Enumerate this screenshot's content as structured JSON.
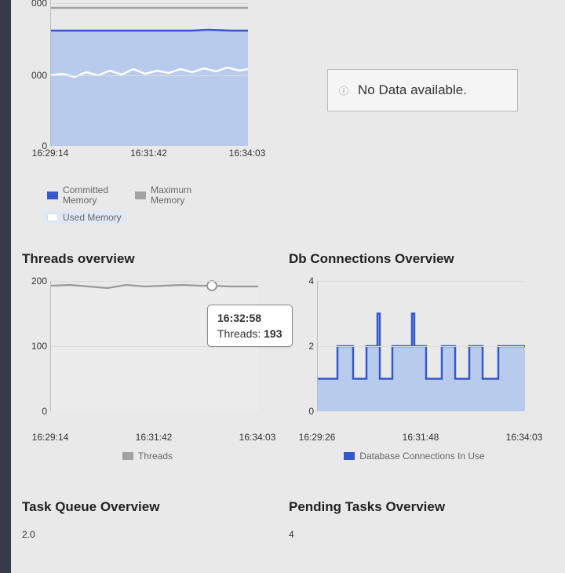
{
  "sidebar": {},
  "nodata": {
    "text": "No Data available."
  },
  "mem_chart": {
    "y_ticks": [
      "000",
      "000",
      "0"
    ],
    "x_ticks": [
      "16:29:14",
      "16:31:42",
      "16:34:03"
    ],
    "legend": {
      "committed": "Committed Memory",
      "maximum": "Maximum Memory",
      "used": "Used Memory"
    }
  },
  "threads_panel": {
    "title": "Threads overview",
    "y_ticks": [
      "200",
      "100",
      "0"
    ],
    "x_ticks": [
      "16:29:14",
      "16:31:42",
      "16:34:03"
    ],
    "legend": {
      "threads": "Threads"
    },
    "tooltip": {
      "time": "16:32:58",
      "label": "Threads:",
      "value": "193"
    }
  },
  "db_panel": {
    "title": "Db Connections Overview",
    "y_ticks": [
      "4",
      "2",
      "0"
    ],
    "x_ticks": [
      "16:29:26",
      "16:31:48",
      "16:34:03"
    ],
    "legend": {
      "db": "Database Connections In Use"
    }
  },
  "task_queue": {
    "title": "Task Queue Overview",
    "first_tick": "2.0"
  },
  "pending_tasks": {
    "title": "Pending Tasks Overview",
    "first_tick": "4"
  },
  "colors": {
    "series_blue": "#3558cc",
    "area_blue": "#b9cbec",
    "grey": "#b0b0b0",
    "white_line": "#ffffff"
  },
  "chart_data": [
    {
      "type": "area",
      "title": "Memory (partial, top cropped)",
      "legend": [
        "Committed Memory",
        "Maximum Memory",
        "Used Memory"
      ],
      "x": [
        "16:29:14",
        "16:31:42",
        "16:34:03"
      ],
      "series": [
        {
          "name": "Committed Memory",
          "note": "flat line near top of visible area",
          "values_relative_0_1": [
            0.795,
            0.795,
            0.795
          ]
        },
        {
          "name": "Maximum Memory",
          "note": "horizontal grey line at very top",
          "values_relative_0_1": [
            0.95,
            0.95,
            0.95
          ]
        },
        {
          "name": "Used Memory",
          "note": "white line over filled area, slight jitter",
          "values_relative_0_1": [
            0.49,
            0.5,
            0.53
          ]
        }
      ],
      "ylim": null,
      "y_tick_labels_visible": [
        "000",
        "000",
        "0"
      ]
    },
    {
      "type": "line",
      "title": "Threads overview",
      "xlabel": "",
      "ylabel": "",
      "ylim": [
        0,
        200
      ],
      "x": [
        "16:29:14",
        "16:29:40",
        "16:30:05",
        "16:30:30",
        "16:30:55",
        "16:31:20",
        "16:31:42",
        "16:32:05",
        "16:32:30",
        "16:32:58",
        "16:33:30",
        "16:34:03"
      ],
      "series": [
        {
          "name": "Threads",
          "values": [
            192,
            193,
            195,
            191,
            194,
            192,
            193,
            194,
            194,
            193,
            192,
            192
          ]
        }
      ],
      "tooltip": {
        "x": "16:32:58",
        "series": "Threads",
        "value": 193
      }
    },
    {
      "type": "area",
      "title": "Db Connections Overview",
      "xlabel": "",
      "ylabel": "",
      "ylim": [
        0,
        4
      ],
      "x": [
        "16:29:26",
        "16:29:45",
        "16:30:05",
        "16:30:20",
        "16:30:40",
        "16:30:55",
        "16:31:05",
        "16:31:15",
        "16:31:20",
        "16:31:35",
        "16:31:48",
        "16:31:52",
        "16:32:00",
        "16:32:20",
        "16:32:40",
        "16:32:55",
        "16:33:10",
        "16:33:25",
        "16:33:40",
        "16:33:55",
        "16:34:03"
      ],
      "series": [
        {
          "name": "Database Connections In Use",
          "values": [
            1,
            1,
            2,
            2,
            1,
            1,
            2,
            3,
            1,
            2,
            2,
            3,
            2,
            1,
            2,
            2,
            1,
            2,
            1,
            2,
            2
          ]
        }
      ]
    },
    {
      "type": "line",
      "title": "Task Queue Overview",
      "y_tick_labels_visible": [
        "2.0"
      ],
      "note": "chart body cropped below viewport"
    },
    {
      "type": "line",
      "title": "Pending Tasks Overview",
      "y_tick_labels_visible": [
        "4"
      ],
      "note": "chart body cropped below viewport"
    }
  ]
}
